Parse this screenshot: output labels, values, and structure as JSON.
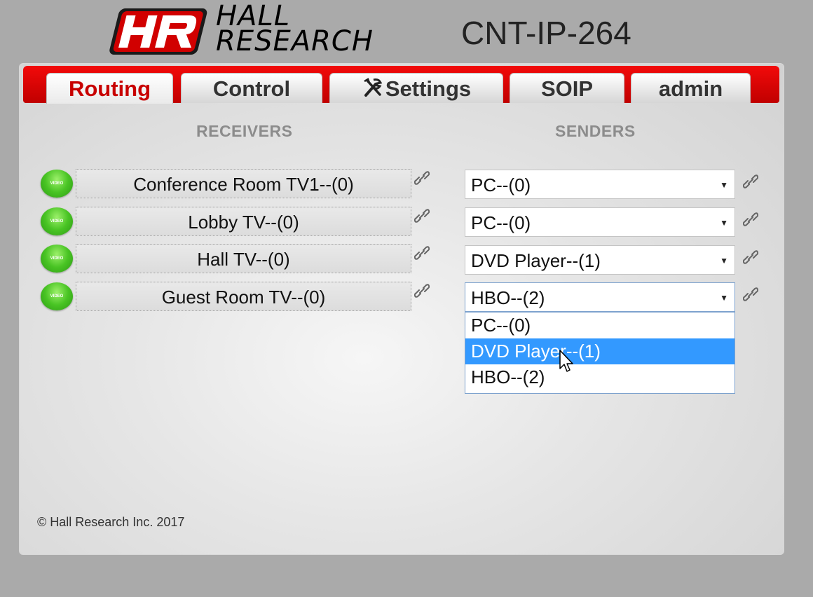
{
  "brand": {
    "logo_mark": "HR",
    "logo_line1": "HALL",
    "logo_line2": "RESEARCH",
    "model": "CNT-IP-264",
    "logo_red": "#d10000"
  },
  "tabs": [
    {
      "label": "Routing",
      "active": true
    },
    {
      "label": "Control",
      "active": false
    },
    {
      "label": "Settings",
      "active": false,
      "icon": "tools-icon"
    },
    {
      "label": "SOIP",
      "active": false
    },
    {
      "label": "admin",
      "active": false
    }
  ],
  "receivers": {
    "heading": "RECEIVERS",
    "items": [
      {
        "name": "Conference Room TV1--(0)",
        "badge": "VIDEO"
      },
      {
        "name": "Lobby TV--(0)",
        "badge": "VIDEO"
      },
      {
        "name": "Hall TV--(0)",
        "badge": "VIDEO"
      },
      {
        "name": "Guest Room TV--(0)",
        "badge": "VIDEO"
      }
    ]
  },
  "senders": {
    "heading": "SENDERS",
    "selected": [
      "PC--(0)",
      "PC--(0)",
      "DVD Player--(1)",
      "HBO--(2)"
    ],
    "dropdown_open_row": 4,
    "options": [
      "PC--(0)",
      "DVD Player--(1)",
      "HBO--(2)"
    ],
    "highlighted_option": "DVD Player--(1)"
  },
  "footer": {
    "copyright": "© Hall Research Inc. 2017"
  },
  "colors": {
    "tab_bar_red": "#e00000",
    "active_tab_text": "#c80000",
    "status_led_green": "#49c424",
    "dropdown_highlight": "#3399ff"
  }
}
